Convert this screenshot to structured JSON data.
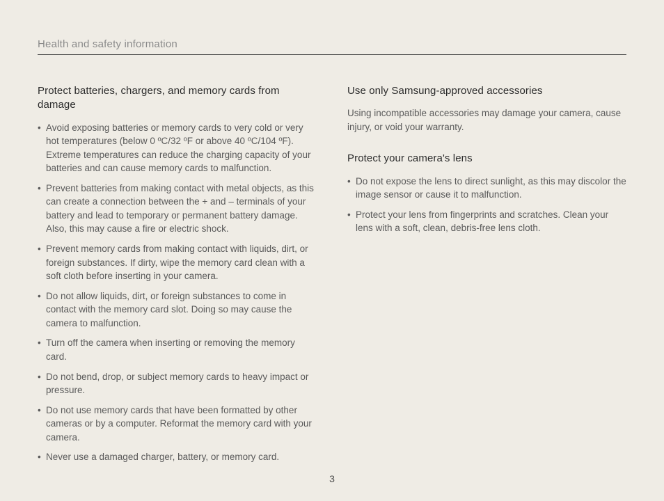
{
  "header": "Health and safety information",
  "page_number": "3",
  "left": {
    "section1": {
      "title": "Protect batteries, chargers, and memory cards from damage",
      "items": [
        "Avoid exposing batteries or memory cards to very cold or very hot temperatures (below 0 ºC/32 ºF or above 40 ºC/104 ºF). Extreme temperatures can reduce the charging capacity of your batteries and can cause memory cards to malfunction.",
        "Prevent batteries from making contact with metal objects, as this can create a connection between the + and – terminals of your battery and lead to temporary or permanent battery damage. Also, this may cause a fire or electric shock.",
        "Prevent memory cards from making contact with liquids, dirt, or foreign substances. If dirty, wipe the memory card clean with a soft cloth before inserting in your camera.",
        "Do not allow liquids, dirt, or foreign substances to come in contact with the memory card slot. Doing so may cause the camera to malfunction.",
        "Turn off the camera when inserting or removing the memory card.",
        "Do not bend, drop, or subject memory cards to heavy impact or pressure.",
        "Do not use memory cards that have been formatted by other cameras or by a computer. Reformat the memory card with your camera.",
        "Never use a damaged charger, battery, or memory card."
      ]
    }
  },
  "right": {
    "section1": {
      "title": "Use only Samsung-approved accessories",
      "para": "Using incompatible accessories may damage your camera, cause injury, or void your warranty."
    },
    "section2": {
      "title": "Protect your camera's lens",
      "items": [
        "Do not expose the lens to direct sunlight, as this may discolor the image sensor or cause it to malfunction.",
        "Protect your lens from fingerprints and scratches. Clean your lens with a soft, clean, debris-free lens cloth."
      ]
    }
  }
}
